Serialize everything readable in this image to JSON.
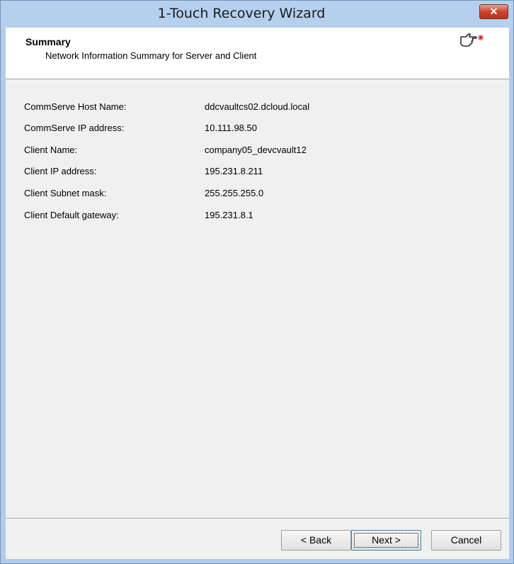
{
  "window": {
    "title": "1-Touch Recovery Wizard",
    "close_symbol": "✕"
  },
  "header": {
    "title": "Summary",
    "subtitle": "Network Information Summary for Server and Client",
    "icon": "pointing-hand-icon"
  },
  "info": [
    {
      "label": "CommServe Host Name:",
      "value": "ddcvaultcs02.dcloud.local"
    },
    {
      "label": "CommServe IP address:",
      "value": "10.111.98.50"
    },
    {
      "label": "Client Name:",
      "value": "company05_devcvault12"
    },
    {
      "label": "Client IP address:",
      "value": "195.231.8.211"
    },
    {
      "label": "Client Subnet mask:",
      "value": "255.255.255.0"
    },
    {
      "label": "Client Default gateway:",
      "value": "195.231.8.1"
    }
  ],
  "buttons": {
    "back": "< Back",
    "next": "Next >",
    "cancel": "Cancel"
  },
  "colors": {
    "titlebar": "#b5d0ee",
    "close": "#c8452f",
    "focus": "#3c7fb1"
  }
}
